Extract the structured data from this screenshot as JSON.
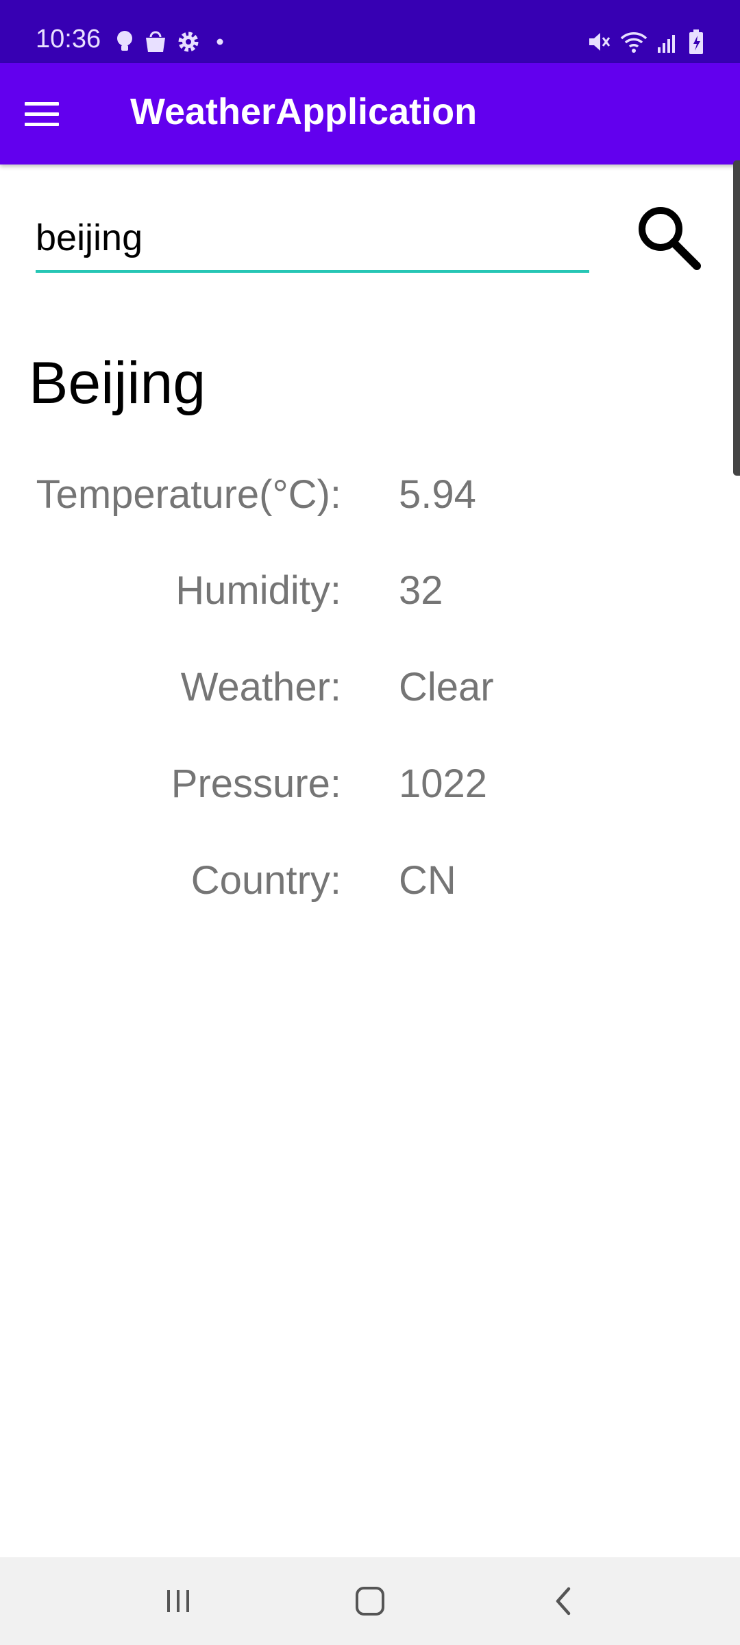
{
  "status_bar": {
    "time": "10:36",
    "left_icons": [
      "bulb-icon",
      "shopping-bag-icon",
      "gear-icon",
      "dot-icon"
    ],
    "right_icons": [
      "mute-icon",
      "wifi-icon",
      "signal-icon",
      "battery-charging-icon"
    ]
  },
  "app_bar": {
    "title": "WeatherApplication",
    "menu_icon": "hamburger-menu-icon"
  },
  "search": {
    "value": "beijing",
    "accent_color": "#26c6b5",
    "button_icon": "search-icon"
  },
  "result": {
    "city": "Beijing",
    "rows": [
      {
        "label": "Temperature(°C):",
        "value": "5.94"
      },
      {
        "label": "Humidity:",
        "value": "32"
      },
      {
        "label": "Weather:",
        "value": "Clear"
      },
      {
        "label": "Pressure:",
        "value": "1022"
      },
      {
        "label": "Country:",
        "value": "CN"
      }
    ]
  },
  "nav_bar": {
    "buttons": [
      "recents-icon",
      "home-icon",
      "back-icon"
    ]
  },
  "colors": {
    "status_bar": "#3700b3",
    "app_bar": "#6200ee",
    "text_secondary": "#757575"
  }
}
